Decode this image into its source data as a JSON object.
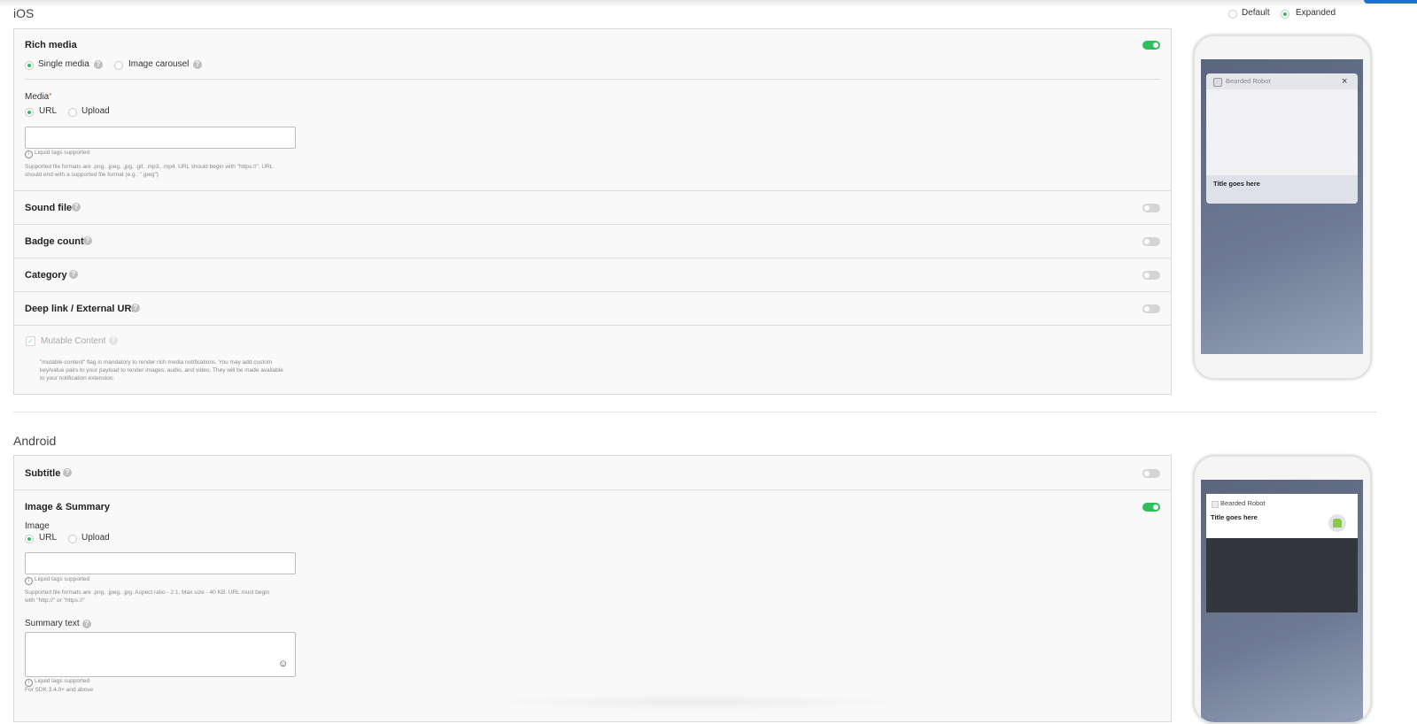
{
  "ios": {
    "section_title": "iOS",
    "view_mode": {
      "default_label": "Default",
      "expanded_label": "Expanded",
      "selected": "Expanded"
    },
    "rich_media": {
      "label": "Rich media",
      "options": [
        "Single media",
        "Image carousel"
      ],
      "selected": "Single media",
      "media_label": "Media",
      "required_mark": "*",
      "source_options": [
        "URL",
        "Upload"
      ],
      "source_selected": "URL",
      "url_value": "",
      "liquid_note": "Liquid tags supported",
      "formats_note_line1": "Supported file formats are .png, .jpeg, .jpg, .gif, .mp3, .mp4. URL should begin with \"https://\". URL",
      "formats_note_line2": "should end with a supported file format (e.g.: \".jpeg\")"
    },
    "rows": [
      {
        "label": "Sound file",
        "on": false
      },
      {
        "label": "Badge count",
        "on": false
      },
      {
        "label": "Category",
        "on": false
      },
      {
        "label": "Deep link / External URL",
        "on": false
      }
    ],
    "mutable": {
      "label": "Mutable Content",
      "note_line1": "\"mutable-content\" flag is mandatory to render rich media notifications. You may add custom",
      "note_line2": "key/value pairs to your payload to render images, audio, and video. They will be made available",
      "note_line3": "to your notification extension."
    },
    "preview": {
      "app_name": "Bearded Robot",
      "title": "Title goes here",
      "close": "×"
    }
  },
  "android": {
    "section_title": "Android",
    "subtitle_label": "Subtitle",
    "image_summary": {
      "label": "Image & Summary",
      "image_label": "Image",
      "source_options": [
        "URL",
        "Upload"
      ],
      "source_selected": "URL",
      "url_value": "",
      "liquid_note": "Liquid tags supported",
      "formats_note_line1": "Supported file formats are .png, .jpeg, .jpg. Aspect ratio - 2:1, Max size - 40 KB. URL must begin",
      "formats_note_line2": "with \"http://\" or \"https://\"",
      "summary_label": "Summary text",
      "summary_value": "",
      "summary_liquid_note": "Liquid tags supported",
      "sdk_note": "For SDK 3.4.0+ and above"
    },
    "preview": {
      "app_name": "Bearded Robot",
      "title": "Title goes here"
    }
  },
  "colors": {
    "toggle_on": "#2fbf5a",
    "primary": "#1f6fd1"
  }
}
